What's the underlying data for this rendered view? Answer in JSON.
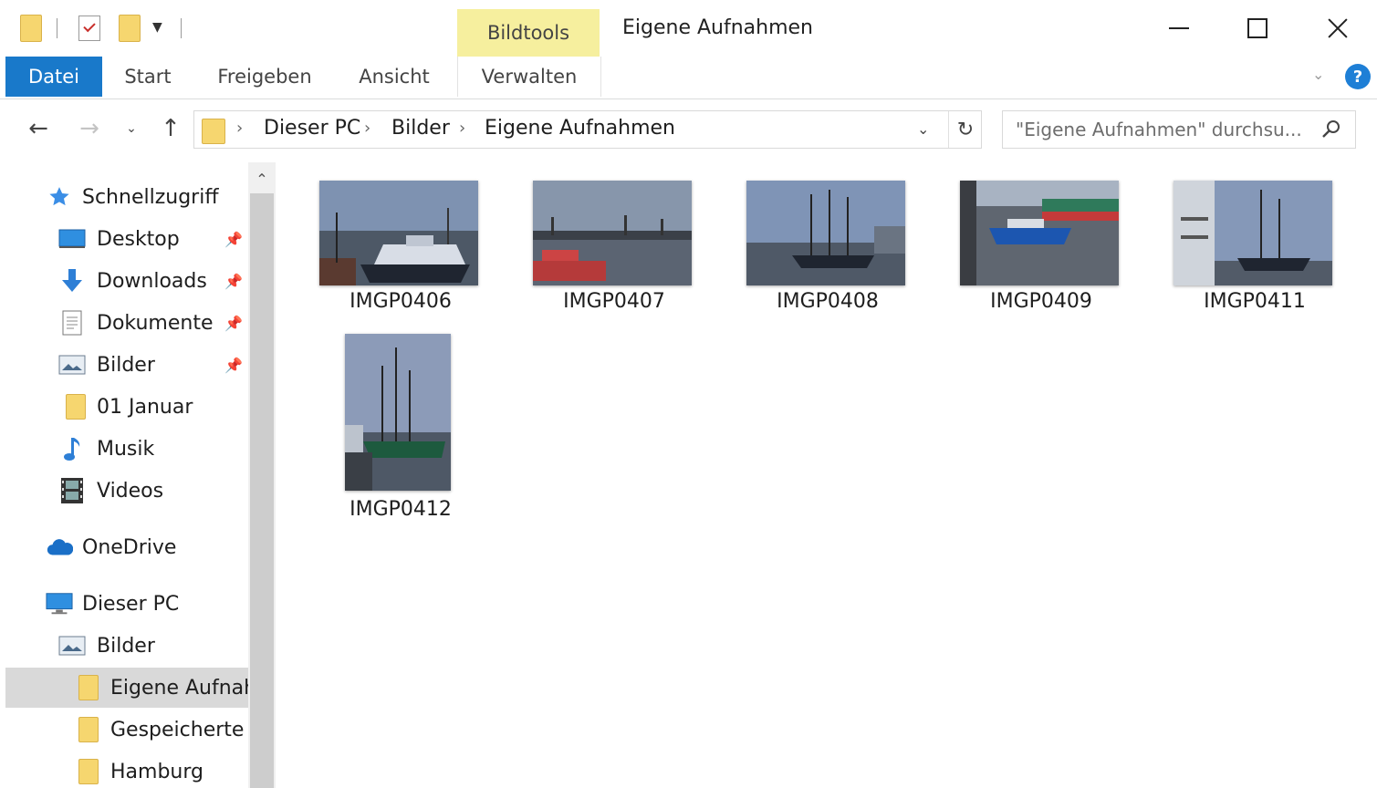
{
  "window": {
    "title": "Eigene Aufnahmen",
    "contextual_tab": "Bildtools"
  },
  "ribbon": {
    "tabs": [
      {
        "label": "Datei",
        "active": true
      },
      {
        "label": "Start"
      },
      {
        "label": "Freigeben"
      },
      {
        "label": "Ansicht"
      },
      {
        "label": "Verwalten"
      }
    ],
    "help_label": "?"
  },
  "address": {
    "breadcrumbs": [
      "Dieser PC",
      "Bilder",
      "Eigene Aufnahmen"
    ]
  },
  "search": {
    "placeholder": "\"Eigene Aufnahmen\" durchsu..."
  },
  "nav": {
    "items": [
      {
        "label": "Schnellzugriff",
        "icon": "star-icon"
      },
      {
        "label": "Desktop",
        "icon": "desktop-icon",
        "pinned": true
      },
      {
        "label": "Downloads",
        "icon": "download-arrow-icon",
        "pinned": true
      },
      {
        "label": "Dokumente",
        "icon": "document-icon",
        "pinned": true
      },
      {
        "label": "Bilder",
        "icon": "pictures-icon",
        "pinned": true
      },
      {
        "label": "01 Januar",
        "icon": "folder-icon"
      },
      {
        "label": "Musik",
        "icon": "music-note-icon"
      },
      {
        "label": "Videos",
        "icon": "film-icon"
      },
      {
        "label": "OneDrive",
        "icon": "cloud-icon"
      },
      {
        "label": "Dieser PC",
        "icon": "computer-icon"
      },
      {
        "label": "Bilder",
        "icon": "pictures-icon"
      },
      {
        "label": "Eigene Aufnah",
        "icon": "folder-icon",
        "selected": true
      },
      {
        "label": "Gespeicherte B",
        "icon": "folder-icon"
      },
      {
        "label": "Hamburg",
        "icon": "folder-icon"
      }
    ]
  },
  "files": [
    {
      "name": "IMGP0406",
      "orientation": "landscape"
    },
    {
      "name": "IMGP0407",
      "orientation": "landscape"
    },
    {
      "name": "IMGP0408",
      "orientation": "landscape"
    },
    {
      "name": "IMGP0409",
      "orientation": "landscape"
    },
    {
      "name": "IMGP0411",
      "orientation": "landscape"
    },
    {
      "name": "IMGP0412",
      "orientation": "portrait"
    }
  ],
  "colors": {
    "accent": "#1979ca",
    "contextual_tab": "#f6ef9e",
    "selection": "#d9d9d9",
    "folder": "#f6d66f"
  }
}
